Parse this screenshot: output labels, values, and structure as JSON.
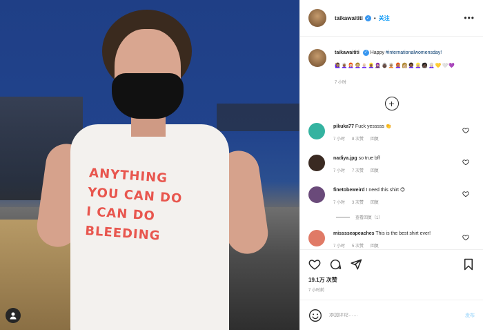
{
  "photo": {
    "shirt_lines": [
      "ANYTHING",
      "YOU CAN DO",
      "I CAN DO",
      "BLEEDING"
    ]
  },
  "header": {
    "username": "taikawaititi",
    "separator": "•",
    "follow_label": "关注",
    "more_label": "•••"
  },
  "caption": {
    "username": "taikawaititi",
    "prefix": "Happy ",
    "hashtag": "#internationalwomensday!",
    "emoji": "🙋🏽‍♀️👩🏾‍🦳👩🏻‍🦰👩🏼‍🦱👩🏻‍🦲👱🏾‍♀️🧕🏼👵🏿🧑🏽‍🦳👩🏽‍🦰👩🏼👩🏾‍🦱👱🏼‍♀️🧑🏿👩🏻‍🦳💛🤍💜",
    "time": "7 小时"
  },
  "comments": [
    {
      "username": "pikuka77",
      "text": "Fuck yesssss 👏",
      "time": "7 小时",
      "likes": "8 次赞",
      "reply": "回复",
      "color": "#34b3a0"
    },
    {
      "username": "nadiya.jpg",
      "text": "so true bff",
      "time": "7 小时",
      "likes": "7 次赞",
      "reply": "回复",
      "color": "#3a2a22"
    },
    {
      "username": "finetobeweird",
      "text": "I need this shirt 😍",
      "time": "7 小时",
      "likes": "3 次赞",
      "reply": "回复",
      "color": "#6a4a7a"
    },
    {
      "username": "misssseapeaches",
      "text": "This is the best shirt ever!",
      "time": "7 小时",
      "likes": "5 次赞",
      "reply": "回复",
      "color": "#e07a66"
    }
  ],
  "replies_label": "查看回复（1）",
  "actions": {
    "likes": "19.1万 次赞",
    "post_time": "7 小时前"
  },
  "add_comment": {
    "placeholder": "添加评论……",
    "post_label": "发布"
  },
  "colors": {
    "accent": "#0095f6",
    "verified": "#3897f0",
    "shirt_text": "#e8564e"
  }
}
